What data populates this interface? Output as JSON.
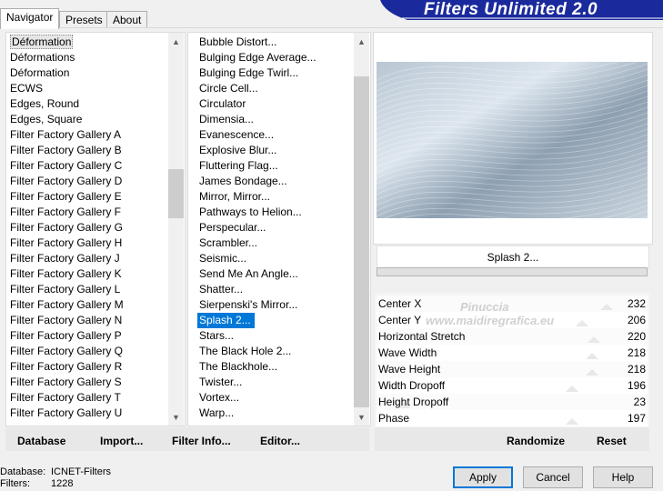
{
  "tabs": [
    "Navigator",
    "Presets",
    "About"
  ],
  "app_title": "Filters Unlimited 2.0",
  "categories": [
    "Déformation",
    "Déformations",
    "Déformation",
    "ECWS",
    "Edges, Round",
    "Edges, Square",
    "Filter Factory Gallery A",
    "Filter Factory Gallery B",
    "Filter Factory Gallery C",
    "Filter Factory Gallery D",
    "Filter Factory Gallery E",
    "Filter Factory Gallery F",
    "Filter Factory Gallery G",
    "Filter Factory Gallery H",
    "Filter Factory Gallery J",
    "Filter Factory Gallery K",
    "Filter Factory Gallery L",
    "Filter Factory Gallery M",
    "Filter Factory Gallery N",
    "Filter Factory Gallery P",
    "Filter Factory Gallery Q",
    "Filter Factory Gallery R",
    "Filter Factory Gallery S",
    "Filter Factory Gallery T",
    "Filter Factory Gallery U"
  ],
  "filters": [
    "Bubble Distort...",
    "Bulging Edge Average...",
    "Bulging Edge Twirl...",
    "Circle Cell...",
    "Circulator",
    "Dimensia...",
    "Evanescence...",
    "Explosive Blur...",
    "Fluttering Flag...",
    "James Bondage...",
    "Mirror, Mirror...",
    "Pathways to Helion...",
    "Perspecular...",
    "Scrambler...",
    "Seismic...",
    "Send Me An Angle...",
    "Shatter...",
    "Sierpenski's Mirror...",
    "Splash 2...",
    "Stars...",
    "The Black Hole 2...",
    "The Blackhole...",
    "Twister...",
    "Vortex...",
    "Warp..."
  ],
  "selected_filter_name": "Splash 2...",
  "params": [
    {
      "label": "Center X",
      "value": "232",
      "level": 0.91
    },
    {
      "label": "Center Y",
      "value": "206",
      "level": 0.81
    },
    {
      "label": "Horizontal Stretch",
      "value": "220",
      "level": 0.86
    },
    {
      "label": "Wave Width",
      "value": "218",
      "level": 0.85
    },
    {
      "label": "Wave Height",
      "value": "218",
      "level": 0.85
    },
    {
      "label": "Width Dropoff",
      "value": "196",
      "level": 0.77
    },
    {
      "label": "Height Dropoff",
      "value": "23",
      "level": 0.09
    },
    {
      "label": "Phase",
      "value": "197",
      "level": 0.77
    }
  ],
  "toolbar": {
    "database": "Database",
    "import": "Import...",
    "filter_info": "Filter Info...",
    "editor": "Editor...",
    "randomize": "Randomize",
    "reset": "Reset"
  },
  "status": {
    "database_label": "Database:",
    "database_value": "ICNET-Filters",
    "filters_label": "Filters:",
    "filters_value": "1228"
  },
  "buttons": {
    "apply": "Apply",
    "cancel": "Cancel",
    "help": "Help"
  },
  "watermark": {
    "line1": "Pinuccia",
    "line2": "www.maidiregrafica.eu"
  }
}
